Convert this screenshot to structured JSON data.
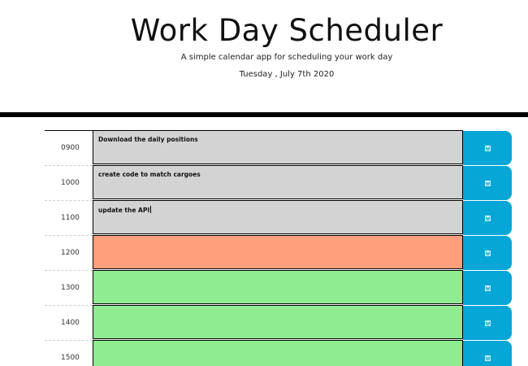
{
  "header": {
    "title": "Work Day Scheduler",
    "subtitle": "A simple calendar app for scheduling your work day",
    "current_date": "Tuesday , July 7th 2020"
  },
  "schedule": {
    "rows": [
      {
        "hour": "0900",
        "text": "Download the daily positions",
        "state": "past"
      },
      {
        "hour": "1000",
        "text": "create code to match cargoes",
        "state": "past"
      },
      {
        "hour": "1100",
        "text": "update the API",
        "state": "past"
      },
      {
        "hour": "1200",
        "text": "",
        "state": "present"
      },
      {
        "hour": "1300",
        "text": "",
        "state": "future"
      },
      {
        "hour": "1400",
        "text": "",
        "state": "future"
      },
      {
        "hour": "1500",
        "text": "",
        "state": "future"
      }
    ],
    "save_icon": "save-icon",
    "colors": {
      "past": "#d3d3d3",
      "present": "#ff9f7b",
      "future": "#90ec90",
      "save_button": "#06a6d6"
    }
  }
}
